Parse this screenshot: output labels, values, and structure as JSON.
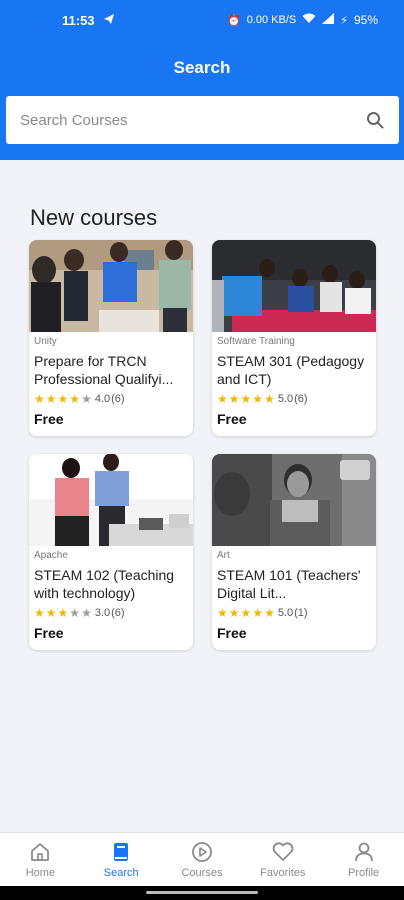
{
  "status_bar": {
    "time": "11:53",
    "left_icon": "telegram-icon",
    "net_speed": "0.00 KB/S",
    "battery": "95%"
  },
  "header": {
    "title": "Search",
    "search_placeholder": "Search Courses"
  },
  "section": {
    "title": "New courses"
  },
  "courses": [
    {
      "category": "Unity",
      "title": "Prepare for TRCN Professional Qualifyi...",
      "rating": 4.0,
      "stars_filled": 4,
      "rating_text": "4.0",
      "reviews": "(6)",
      "price": "Free"
    },
    {
      "category": "Software Training",
      "title": "STEAM 301 (Pedagogy and ICT)",
      "rating": 5.0,
      "stars_filled": 5,
      "rating_text": "5.0",
      "reviews": "(6)",
      "price": "Free"
    },
    {
      "category": "Apache",
      "title": "STEAM 102 (Teaching with technology)",
      "rating": 3.0,
      "stars_filled": 3,
      "rating_text": "3.0",
      "reviews": "(6)",
      "price": "Free"
    },
    {
      "category": "Art",
      "title": "STEAM 101 (Teachers' Digital Lit...",
      "rating": 5.0,
      "stars_filled": 5,
      "rating_text": "5.0",
      "reviews": "(1)",
      "price": "Free"
    }
  ],
  "bottom_nav": [
    {
      "label": "Home",
      "icon": "home-icon"
    },
    {
      "label": "Search",
      "icon": "book-icon",
      "active": true
    },
    {
      "label": "Courses",
      "icon": "play-circle-icon"
    },
    {
      "label": "Favorites",
      "icon": "heart-icon"
    },
    {
      "label": "Profile",
      "icon": "person-icon"
    }
  ],
  "colors": {
    "primary": "#1976f2",
    "star": "#f5b800",
    "background": "#f1f3f8"
  }
}
